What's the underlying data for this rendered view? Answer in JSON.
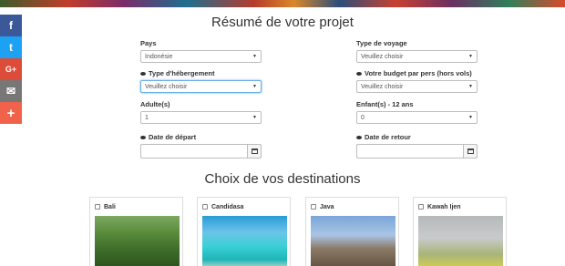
{
  "share": {
    "facebook": "f",
    "twitter": "t",
    "googleplus": "G+",
    "email": "✉",
    "more": "+"
  },
  "summary": {
    "title": "Résumé de votre projet",
    "fields": {
      "pays": {
        "label": "Pays",
        "value": "Indonésie"
      },
      "type_voyage": {
        "label": "Type de voyage",
        "value": "Veuillez choisir"
      },
      "hebergement": {
        "label": "Type d'hébergement",
        "value": "Veuillez choisir"
      },
      "budget": {
        "label": "Votre budget par pers (hors vols)",
        "value": "Veuillez choisir"
      },
      "adultes": {
        "label": "Adulte(s)",
        "value": "1"
      },
      "enfants": {
        "label": "Enfant(s) - 12 ans",
        "value": "0"
      },
      "depart": {
        "label": "Date de départ",
        "value": ""
      },
      "retour": {
        "label": "Date de retour",
        "value": ""
      }
    }
  },
  "destinations": {
    "title": "Choix de vos destinations",
    "items": [
      {
        "name": "Bali"
      },
      {
        "name": "Candidasa"
      },
      {
        "name": "Java"
      },
      {
        "name": "Kawah Ijen"
      }
    ]
  },
  "icons": {
    "eye": "eye-icon",
    "calendar": "calendar-icon",
    "caret": "caret-down-icon"
  }
}
